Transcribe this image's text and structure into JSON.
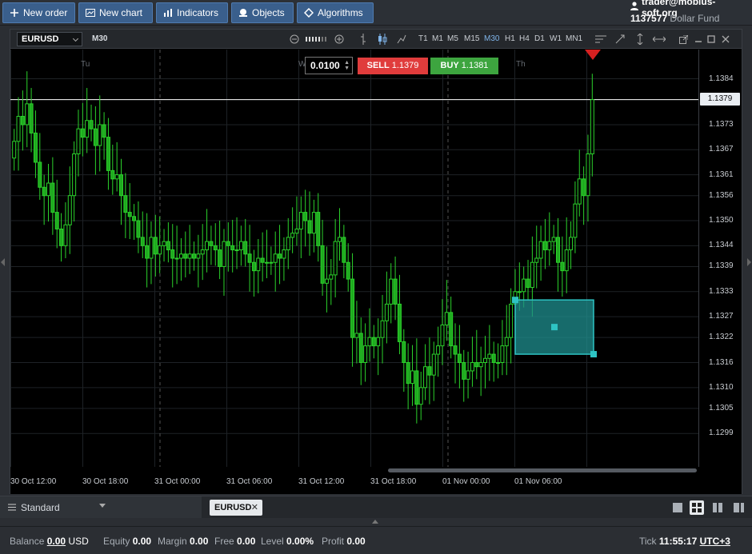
{
  "toolbar": {
    "new_order": "New order",
    "new_chart": "New chart",
    "indicators": "Indicators",
    "objects": "Objects",
    "algorithms": "Algorithms"
  },
  "account": {
    "user": "trader@mobius-soft.org",
    "number": "1137577",
    "fund": "Dollar Fund"
  },
  "chart_header": {
    "symbol": "EURUSD",
    "timeframe": "M30",
    "timeframes": [
      "T1",
      "M1",
      "M5",
      "M15",
      "M30",
      "H1",
      "H4",
      "D1",
      "W1",
      "MN1"
    ],
    "active_timeframe": "M30"
  },
  "trade": {
    "lot": "0.0100",
    "sell_label": "SELL",
    "sell_price": "1.1379",
    "buy_label": "BUY",
    "buy_price": "1.1381"
  },
  "chart_data": {
    "type": "candlestick",
    "day_labels": [
      "Tu",
      "W",
      "Th"
    ],
    "y_ticks": [
      1.1384,
      1.1379,
      1.1373,
      1.1367,
      1.1361,
      1.1356,
      1.135,
      1.1344,
      1.1339,
      1.1333,
      1.1327,
      1.1322,
      1.1316,
      1.131,
      1.1305,
      1.1299
    ],
    "y_tick_labels": [
      "1.1384",
      "1.1373",
      "1.1367",
      "1.1361",
      "1.1356",
      "1.1350",
      "1.1344",
      "1.1339",
      "1.1333",
      "1.1327",
      "1.1322",
      "1.1316",
      "1.1310",
      "1.1305",
      "1.1299"
    ],
    "current_price": "1.1379",
    "x_labels": [
      "30 Oct 12:00",
      "30 Oct 18:00",
      "31 Oct 00:00",
      "31 Oct 06:00",
      "31 Oct 12:00",
      "31 Oct 18:00",
      "01 Nov 00:00",
      "01 Nov 06:00"
    ],
    "ylim": [
      1.1291,
      1.1391
    ],
    "colors": {
      "up": "#22c422",
      "down": "#1faa1f",
      "grid": "#1e2226",
      "rect": "#1f8f8f"
    },
    "closes": [
      1.1369,
      1.1375,
      1.1373,
      1.1378,
      1.1371,
      1.1364,
      1.1358,
      1.1356,
      1.1359,
      1.1352,
      1.1348,
      1.1344,
      1.1349,
      1.1356,
      1.1366,
      1.1372,
      1.137,
      1.1374,
      1.1372,
      1.1368,
      1.1373,
      1.137,
      1.1362,
      1.136,
      1.1361,
      1.1356,
      1.1352,
      1.1351,
      1.135,
      1.1346,
      1.1344,
      1.1341,
      1.1346,
      1.1342,
      1.1344,
      1.1345,
      1.1343,
      1.1341,
      1.1341,
      1.1342,
      1.1341,
      1.1342,
      1.1341,
      1.1342,
      1.1343,
      1.1345,
      1.1344,
      1.1343,
      1.1339,
      1.1345,
      1.1344,
      1.1343,
      1.1343,
      1.1345,
      1.1342,
      1.134,
      1.1338,
      1.1341,
      1.134,
      1.134,
      1.134,
      1.1342,
      1.1341,
      1.1343,
      1.1346,
      1.1347,
      1.1348,
      1.1352,
      1.135,
      1.1347,
      1.1352,
      1.1344,
      1.1335,
      1.1336,
      1.1337,
      1.1345,
      1.1346,
      1.134,
      1.1336,
      1.1322,
      1.1323,
      1.1316,
      1.132,
      1.1322,
      1.132,
      1.1322,
      1.1326,
      1.133,
      1.1336,
      1.133,
      1.1321,
      1.1316,
      1.1311,
      1.1314,
      1.1306,
      1.131,
      1.1315,
      1.1313,
      1.1318,
      1.132,
      1.1325,
      1.1328,
      1.132,
      1.1318,
      1.1316,
      1.1312,
      1.1314,
      1.1316,
      1.1315,
      1.1316,
      1.1317,
      1.1318,
      1.1316,
      1.1316,
      1.132,
      1.1322,
      1.133,
      1.1333,
      1.1333,
      1.1336,
      1.1334,
      1.134,
      1.1341,
      1.1345,
      1.1343,
      1.1345,
      1.1346,
      1.134,
      1.1338,
      1.1343,
      1.1346,
      1.1354,
      1.136,
      1.1356,
      1.1366,
      1.1379
    ],
    "drawn_rect": {
      "price_top": 1.1331,
      "price_bottom": 1.1318
    }
  },
  "tabs": {
    "workspace": "Standard",
    "chart_tab": "EURUSD"
  },
  "status": {
    "balance_label": "Balance",
    "balance": "0.00",
    "currency": "USD",
    "equity_label": "Equity",
    "equity": "0.00",
    "margin_label": "Margin",
    "margin": "0.00",
    "free_label": "Free",
    "free": "0.00",
    "level_label": "Level",
    "level": "0.00%",
    "profit_label": "Profit",
    "profit": "0.00",
    "tick_label": "Tick",
    "time": "11:55:17",
    "timezone": "UTC+3"
  }
}
